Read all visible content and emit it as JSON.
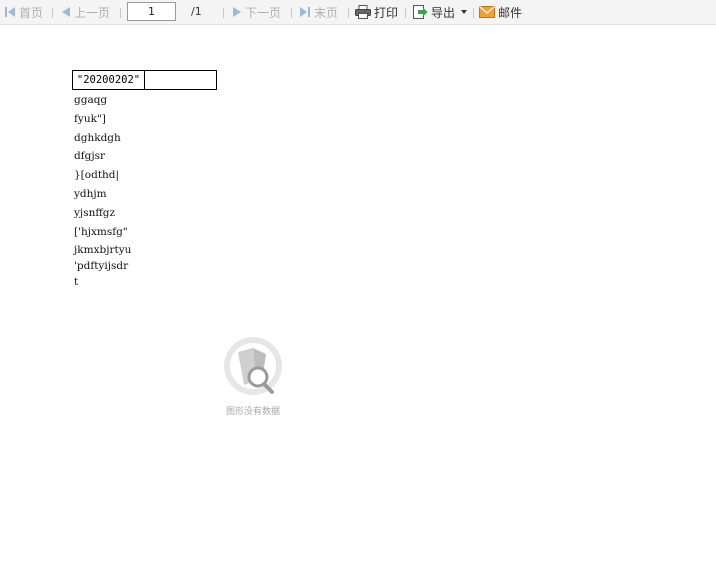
{
  "toolbar": {
    "first_label": "首页",
    "prev_label": "上一页",
    "page_value": "1",
    "page_total": "/1",
    "next_label": "下一页",
    "last_label": "末页",
    "print_label": "打印",
    "export_label": "导出",
    "mail_label": "邮件"
  },
  "report": {
    "header_cell": "\"20200202\"",
    "header_cell_2": "",
    "lines": [
      "ggaqg",
      "fyuk\"]",
      "dghkdgh",
      "dfgjsr",
      "}[odthd|",
      "ydhjm",
      "yjsnffgz",
      "['hjxmsfg\"",
      "jkmxbjrtyu",
      "'pdftyijsdr",
      "t"
    ]
  },
  "chart": {
    "no_data_text": "图形没有数据"
  },
  "colors": {
    "toolbar_bg": "#f4f4f4",
    "disabled_text": "#b0b0b0",
    "nav_icon": "#9fb8d4",
    "export_green": "#3aa64a",
    "mail_orange": "#f0a030"
  }
}
